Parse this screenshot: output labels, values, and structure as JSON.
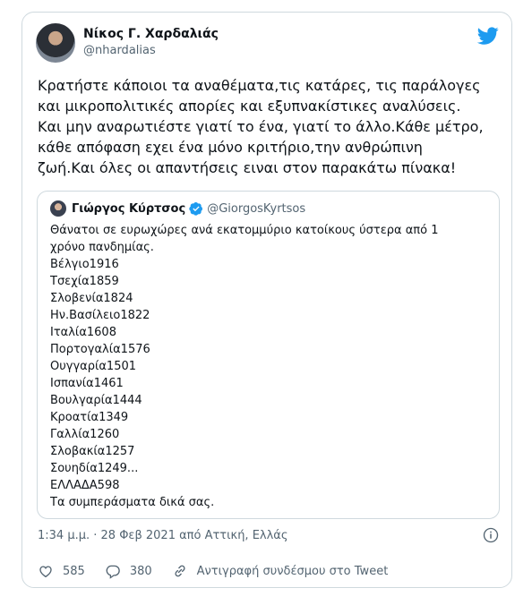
{
  "tweet": {
    "author_name": "Νίκος Γ. Χαρδαλιάς",
    "author_handle": "@nhardalias",
    "lines": [
      "Κρατήστε κάποιοι τα αναθέματα,τις κατάρες, τις παράλογες",
      "και μικροπολιτικές απορίες και εξυπνακίστικες αναλύσεις.",
      "Και μην αναρωτιέστε  γιατί το ένα, γιατί το άλλο.Κάθε μέτρο,",
      "κάθε απόφαση εχει ένα μόνο κριτήριο,την ανθρώπινη",
      "ζωή.Και όλες οι απαντήσεις ειναι στον παρακάτω πίνακα!"
    ],
    "timestamp": "1:34 μ.μ. · 28 Φεβ 2021 από Αττική, Ελλάς"
  },
  "quote": {
    "author_name": "Γιώργος Κύρτσος",
    "author_handle": "@GiorgosKyrtsos",
    "lines": [
      "Θάνατοι σε ευρωχώρες ανά εκατομμύριο κατοίκους ύστερα από 1",
      "χρόνο πανδημίας.",
      "Βέλγιο1916",
      "Τσεχία1859",
      "Σλοβενία1824",
      "Ην.Βασίλειο1822",
      "Ιταλία1608",
      "Πορτογαλία1576",
      "Ουγγαρία1501",
      "Ισπανία1461",
      "Βουλγαρία1444",
      "Κροατία1349",
      "Γαλλία1260",
      "Σλοβακία1257",
      "Σουηδία1249...",
      "ΕΛΛΑΔΑ598",
      "Τα συμπεράσματα δικά σας."
    ]
  },
  "actions": {
    "likes": "585",
    "replies": "380",
    "copy_link_label": "Αντιγραφή συνδέσμου στο Tweet"
  },
  "colors": {
    "brand": "#1d9bf0",
    "muted": "#536471",
    "text": "#0f1419",
    "border": "#cfd9de"
  },
  "icons": [
    "twitter-bird-icon",
    "verified-icon",
    "info-icon",
    "heart-icon",
    "reply-icon",
    "link-icon"
  ]
}
